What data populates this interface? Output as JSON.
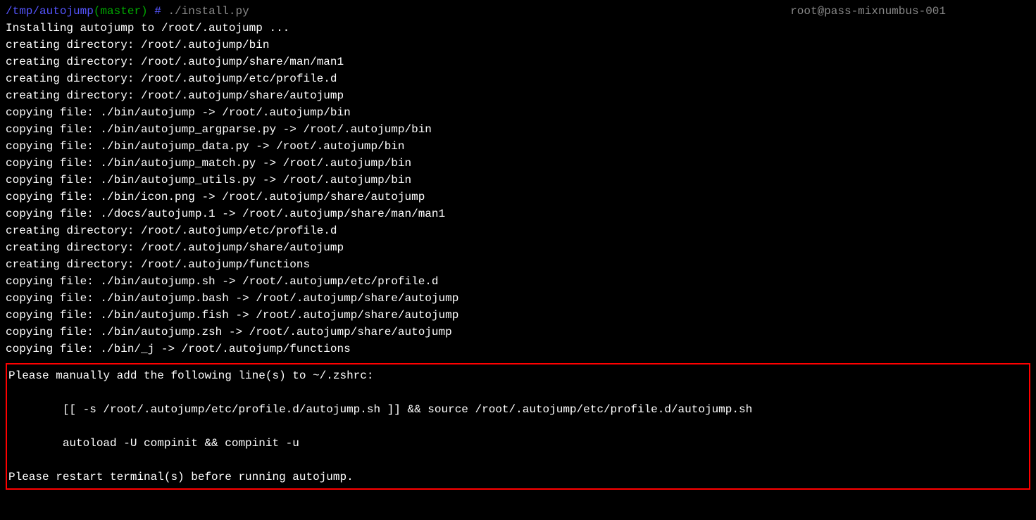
{
  "prompt": {
    "path": "/tmp/autojump",
    "branch": "(master)",
    "hash": " # ",
    "command": "./install.py"
  },
  "host": "root@pass-mixnumbus-001",
  "output": [
    "Installing autojump to /root/.autojump ...",
    "creating directory: /root/.autojump/bin",
    "creating directory: /root/.autojump/share/man/man1",
    "creating directory: /root/.autojump/etc/profile.d",
    "creating directory: /root/.autojump/share/autojump",
    "copying file: ./bin/autojump -> /root/.autojump/bin",
    "copying file: ./bin/autojump_argparse.py -> /root/.autojump/bin",
    "copying file: ./bin/autojump_data.py -> /root/.autojump/bin",
    "copying file: ./bin/autojump_match.py -> /root/.autojump/bin",
    "copying file: ./bin/autojump_utils.py -> /root/.autojump/bin",
    "copying file: ./bin/icon.png -> /root/.autojump/share/autojump",
    "copying file: ./docs/autojump.1 -> /root/.autojump/share/man/man1",
    "creating directory: /root/.autojump/etc/profile.d",
    "creating directory: /root/.autojump/share/autojump",
    "creating directory: /root/.autojump/functions",
    "copying file: ./bin/autojump.sh -> /root/.autojump/etc/profile.d",
    "copying file: ./bin/autojump.bash -> /root/.autojump/share/autojump",
    "copying file: ./bin/autojump.fish -> /root/.autojump/share/autojump",
    "copying file: ./bin/autojump.zsh -> /root/.autojump/share/autojump",
    "copying file: ./bin/_j -> /root/.autojump/functions"
  ],
  "highlight": [
    "Please manually add the following line(s) to ~/.zshrc:",
    "",
    "        [[ -s /root/.autojump/etc/profile.d/autojump.sh ]] && source /root/.autojump/etc/profile.d/autojump.sh",
    "",
    "        autoload -U compinit && compinit -u",
    "",
    "Please restart terminal(s) before running autojump."
  ]
}
